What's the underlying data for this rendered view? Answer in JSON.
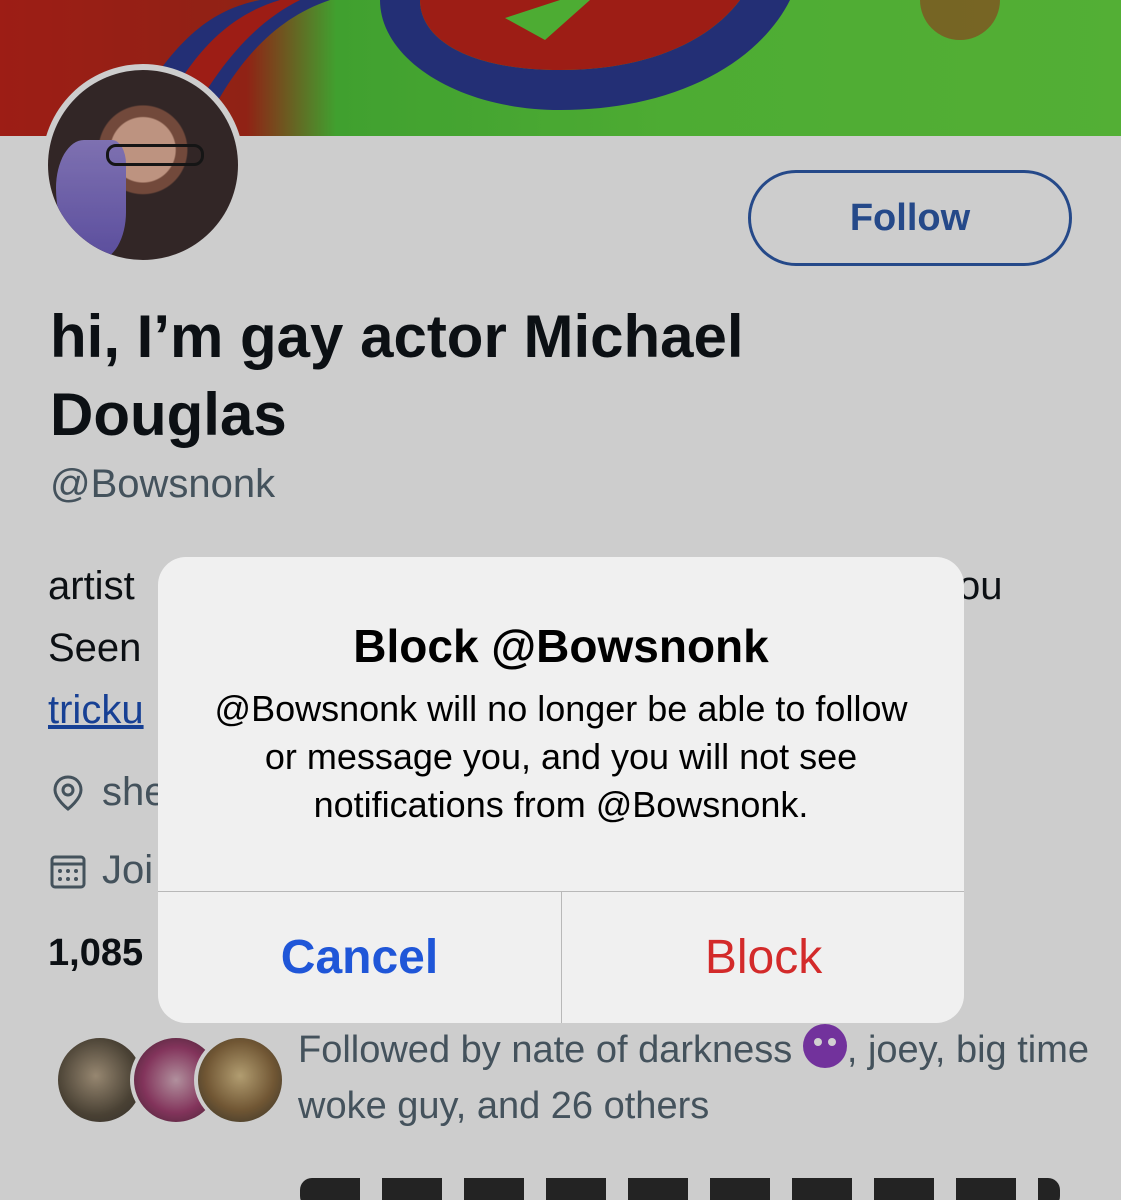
{
  "profile": {
    "follow_label": "Follow",
    "display_name": "hi, I’m gay actor Michael Douglas",
    "handle": "@Bowsnonk",
    "bio_fragments": {
      "line1_start": "artist",
      "line1_end": "ou",
      "line2_start": "Seen",
      "line3_link_start": "tricku"
    },
    "location_fragment": "she",
    "joined_fragment": "Joi",
    "following_count_fragment": "1,085"
  },
  "followed_by": {
    "prefix": "Followed by nate of darkness",
    "suffix": ", joey, big time woke guy, and 26 others",
    "emoji": "smiling-devil"
  },
  "alert": {
    "title": "Block @Bowsnonk",
    "message": "@Bowsnonk will no longer be able to follow or message you, and you will not see notifications from @Bowsnonk.",
    "cancel_label": "Cancel",
    "block_label": "Block"
  },
  "colors": {
    "link_blue": "#1f56d8",
    "destructive_red": "#d32a2a",
    "follow_outline": "#2e5aa8"
  }
}
